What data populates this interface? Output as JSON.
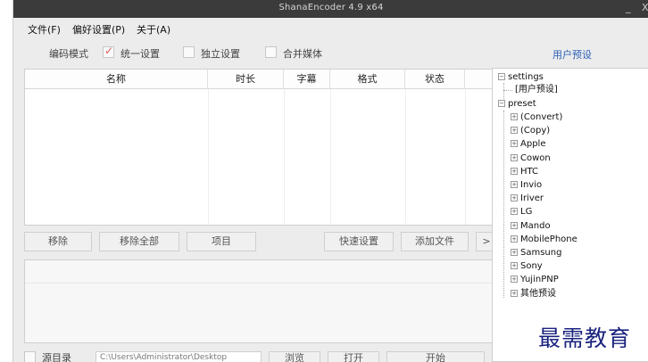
{
  "window": {
    "title": "ShanaEncoder 4.9 x64",
    "minimize_glyph": "_",
    "close_glyph": "X"
  },
  "menu": [
    {
      "label": "文件(F)"
    },
    {
      "label": "偏好设置(P)"
    },
    {
      "label": "关于(A)"
    }
  ],
  "options": {
    "encode_mode_label": "编码模式",
    "unified_label": "统一设置",
    "unified_checked": true,
    "independent_label": "独立设置",
    "independent_checked": false,
    "merge_label": "合并媒体",
    "merge_checked": false
  },
  "user_preset_label": "用户预设",
  "file_list": {
    "columns": [
      "名称",
      "时长",
      "字幕",
      "格式",
      "状态"
    ],
    "rows": []
  },
  "buttons": {
    "remove": "移除",
    "remove_all": "移除全部",
    "item": "项目",
    "quick_settings": "快速设置",
    "add_file": "添加文件",
    "more": ">"
  },
  "bottom": {
    "source_label": "源目录",
    "path": "C:\\Users\\Administrator\\Desktop",
    "browse": "浏览",
    "open": "打开",
    "start": "开始"
  },
  "tree": {
    "settings_label": "settings",
    "user_preset_child": "[用户预设]",
    "preset_label": "preset",
    "preset_children": [
      "(Convert)",
      "(Copy)",
      "Apple",
      "Cowon",
      "HTC",
      "Invio",
      "Iriver",
      "LG",
      "Mando",
      "MobilePhone",
      "Samsung",
      "Sony",
      "YujinPNP",
      "其他预设"
    ]
  },
  "watermark": "最需教育",
  "colors": {
    "titlebar": "#3b3b3b",
    "accent_link": "#2b5fb8",
    "check_mark": "#dd5555",
    "watermark": "#1a237e"
  }
}
